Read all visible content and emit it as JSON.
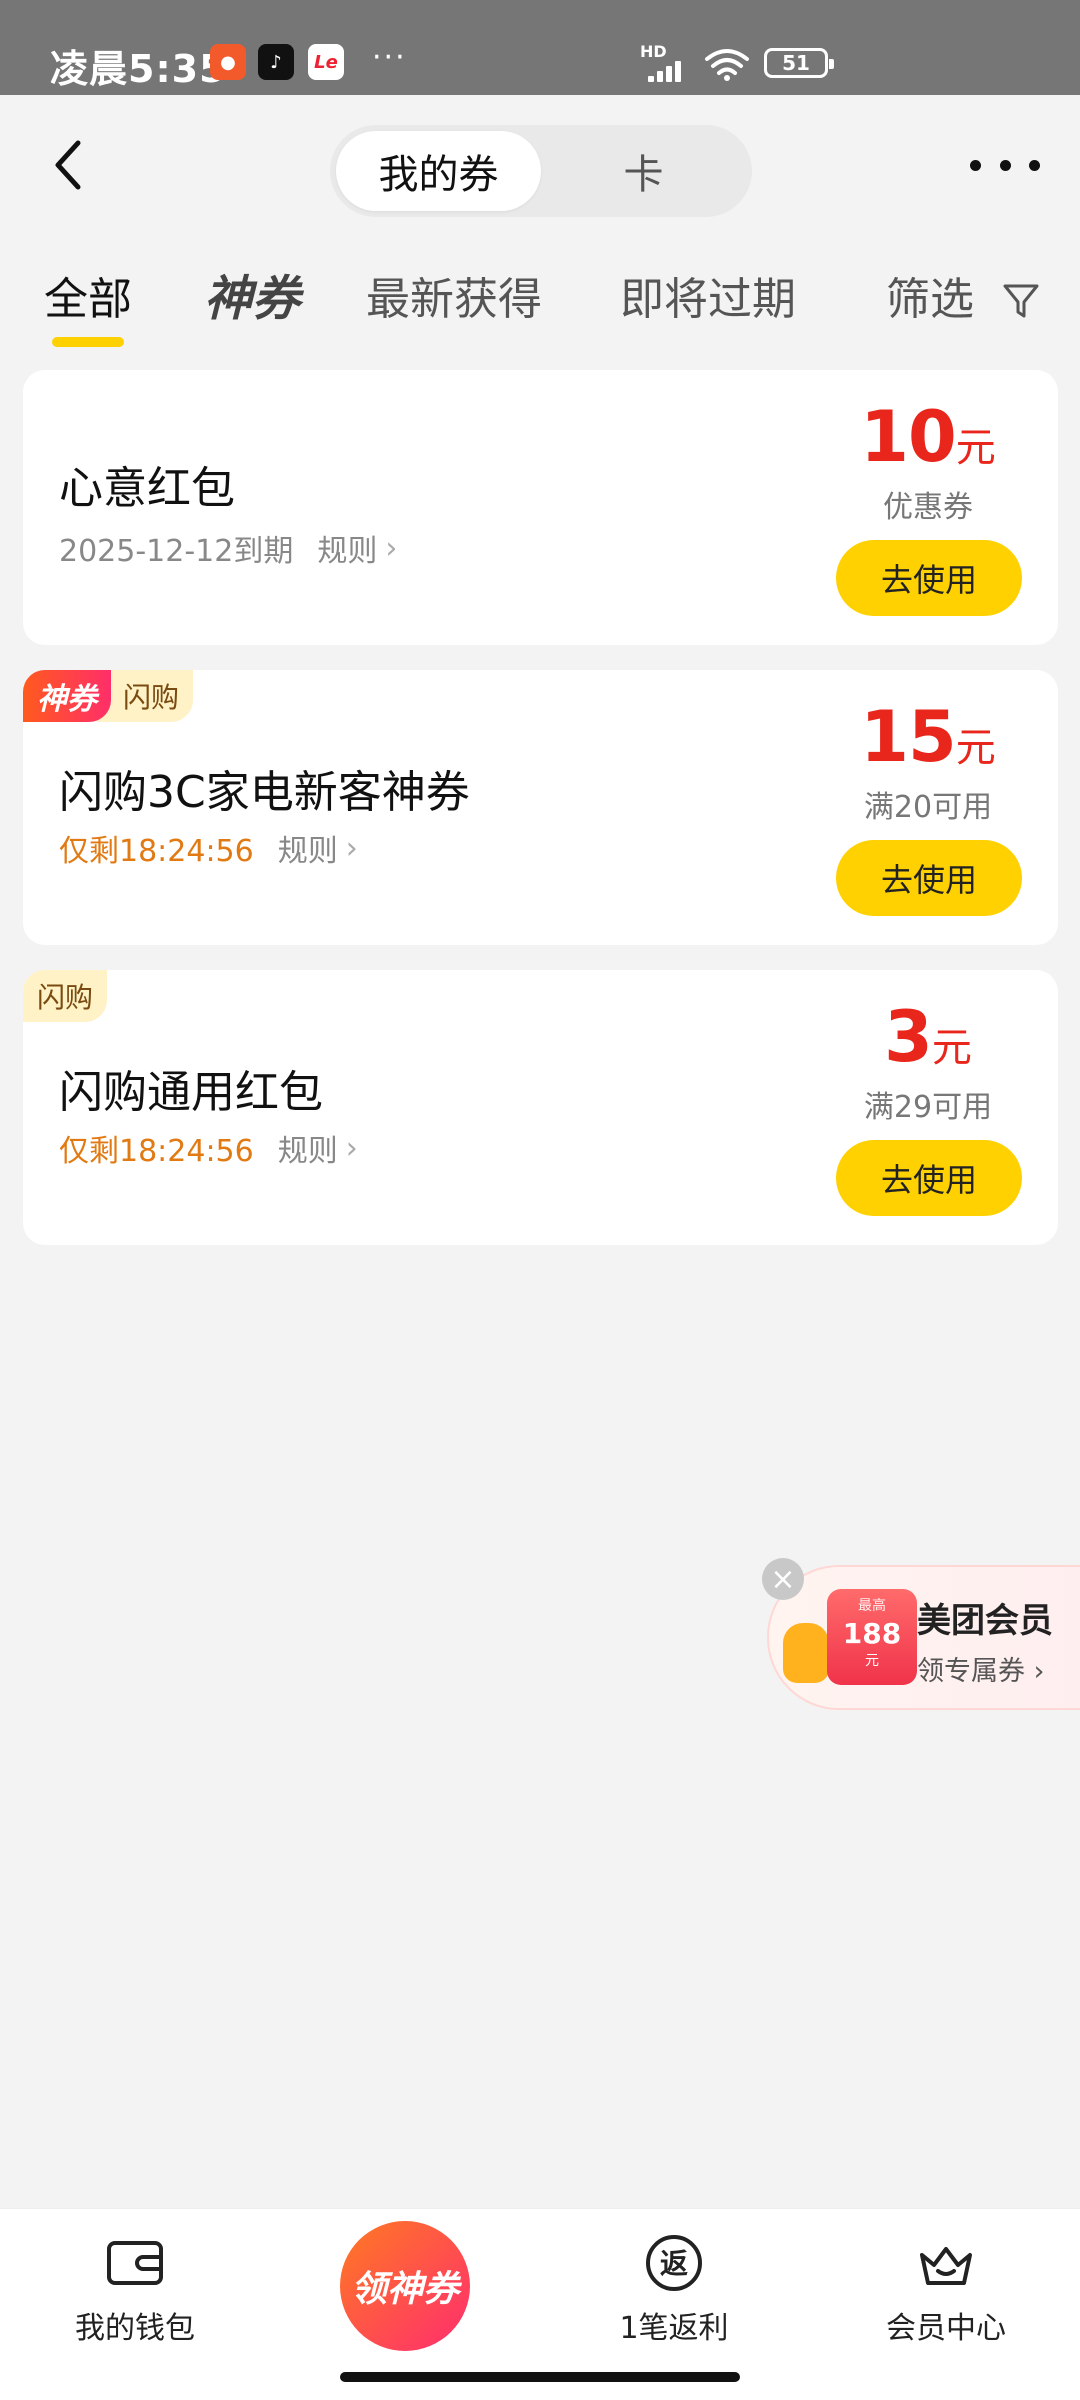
{
  "status_bar": {
    "time": "凌晨5:35",
    "apps": [
      "app1-icon",
      "tiktok-icon",
      "le-icon"
    ],
    "more": "···",
    "hd": "HD",
    "battery": "51"
  },
  "header": {
    "segments": [
      {
        "label": "我的券",
        "active": true
      },
      {
        "label": "卡",
        "active": false
      }
    ]
  },
  "tabs": [
    {
      "label": "全部",
      "active": true
    },
    {
      "label": "神券"
    },
    {
      "label": "最新获得"
    },
    {
      "label": "即将过期"
    },
    {
      "label": "筛选"
    }
  ],
  "coupons": [
    {
      "title": "心意红包",
      "meta": "2025-12-12到期",
      "rule": "规则",
      "amount": "10",
      "unit": "元",
      "condition": "优惠券",
      "button": "去使用"
    },
    {
      "tags": [
        "神券",
        "闪购"
      ],
      "title": "闪购3C家电新客神券",
      "meta": "仅剩18:24:56",
      "rule": "规则",
      "amount": "15",
      "unit": "元",
      "condition": "满20可用",
      "button": "去使用"
    },
    {
      "tags": [
        "闪购"
      ],
      "title": "闪购通用红包",
      "meta": "仅剩18:24:56",
      "rule": "规则",
      "amount": "3",
      "unit": "元",
      "condition": "满29可用",
      "button": "去使用"
    }
  ],
  "promo": {
    "coupon_top": "最高",
    "coupon_value": "188",
    "coupon_unit": "元",
    "title": "美团会员",
    "subtitle": "领专属券"
  },
  "bottom_nav": [
    {
      "label": "我的钱包",
      "icon": "wallet-icon"
    },
    {
      "label": "领神券",
      "icon": "center-coupon"
    },
    {
      "label": "1笔返利",
      "icon": "rebate-icon",
      "icon_char": "返"
    },
    {
      "label": "会员中心",
      "icon": "crown-basket-icon"
    }
  ],
  "colors": {
    "accent_yellow": "#ffd100",
    "price_red": "#e8261b",
    "countdown_orange": "#e27a14",
    "background": "#f4f3f4"
  }
}
